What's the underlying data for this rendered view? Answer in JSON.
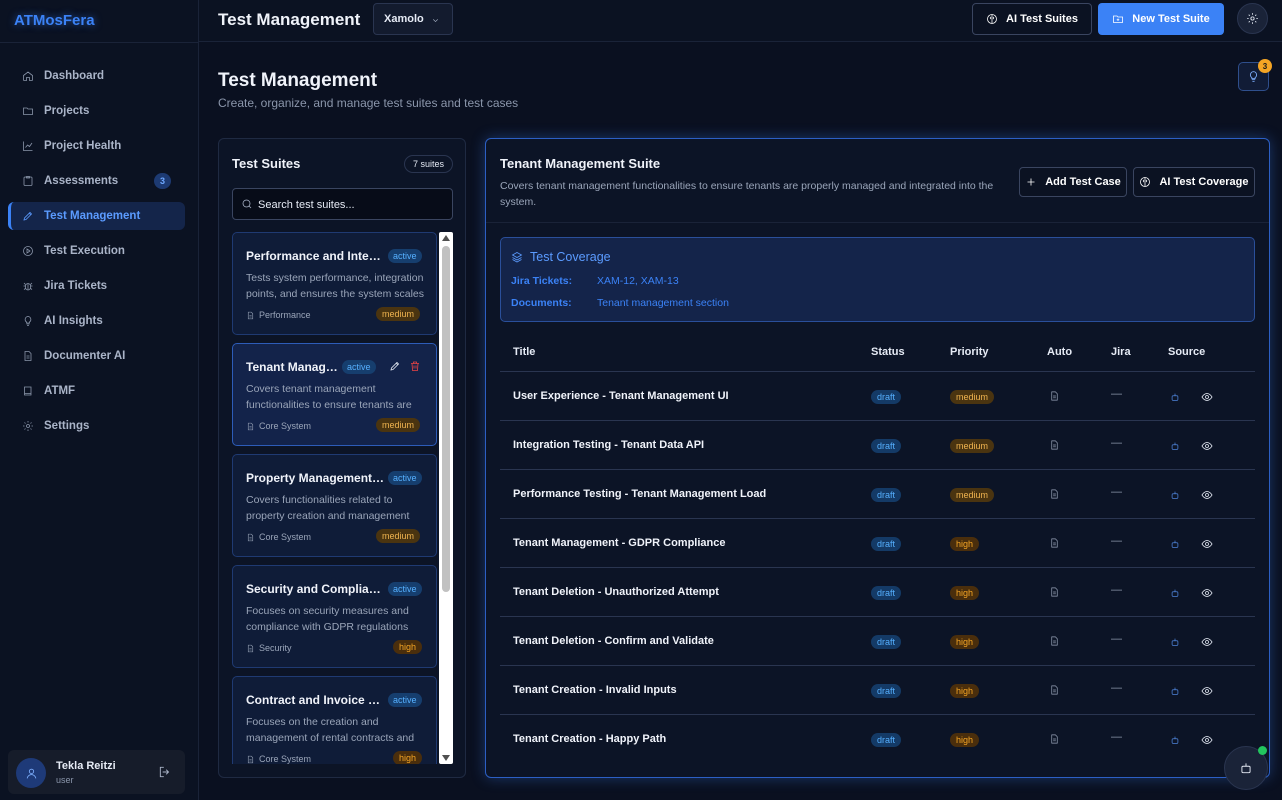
{
  "app": {
    "brand": "ATMosFera"
  },
  "nav": [
    {
      "label": "Dashboard",
      "icon": "home-icon"
    },
    {
      "label": "Projects",
      "icon": "folder-icon"
    },
    {
      "label": "Project Health",
      "icon": "chart-icon"
    },
    {
      "label": "Assessments",
      "icon": "clipboard-icon",
      "badge": "3"
    },
    {
      "label": "Test Management",
      "icon": "pencil-icon",
      "active": true
    },
    {
      "label": "Test Execution",
      "icon": "play-icon"
    },
    {
      "label": "Jira Tickets",
      "icon": "bug-icon"
    },
    {
      "label": "AI Insights",
      "icon": "lightbulb-icon"
    },
    {
      "label": "Documenter AI",
      "icon": "document-icon"
    },
    {
      "label": "ATMF",
      "icon": "book-icon"
    },
    {
      "label": "Settings",
      "icon": "gear-icon"
    }
  ],
  "user": {
    "name": "Tekla Reitzi",
    "role": "user"
  },
  "topbar": {
    "title": "Test Management",
    "project": "Xamolo",
    "ai_button": "AI Test Suites",
    "new_button": "New Test Suite"
  },
  "page": {
    "title": "Test Management",
    "subtitle": "Create, organize, and manage test suites and test cases",
    "insights_count": "3"
  },
  "suites": {
    "title": "Test Suites",
    "count_label": "7 suites",
    "search_placeholder": "Search test suites...",
    "items": [
      {
        "name": "Performance and Integration Testing",
        "status": "active",
        "description": "Tests system performance, integration points, and ensures the system scales",
        "category": "Performance",
        "priority": "medium"
      },
      {
        "name": "Tenant Management Suite",
        "status": "active",
        "description": "Covers tenant management functionalities to ensure tenants are properly managed",
        "category": "Core System",
        "priority": "medium",
        "selected": true
      },
      {
        "name": "Property Management Suite",
        "status": "active",
        "description": "Covers functionalities related to property creation and management",
        "category": "Core System",
        "priority": "medium"
      },
      {
        "name": "Security and Compliance",
        "status": "active",
        "description": "Focuses on security measures and compliance with GDPR regulations",
        "category": "Security",
        "priority": "high"
      },
      {
        "name": "Contract and Invoice Management",
        "status": "active",
        "description": "Focuses on the creation and management of rental contracts and invoices",
        "category": "Core System",
        "priority": "high"
      }
    ]
  },
  "detail": {
    "title": "Tenant Management Suite",
    "description": "Covers tenant management functionalities to ensure tenants are properly managed and integrated into the system.",
    "add_button": "Add Test Case",
    "coverage_button": "AI Test Coverage",
    "coverage": {
      "title": "Test Coverage",
      "jira_label": "Jira Tickets:",
      "jira_value": "XAM-12, XAM-13",
      "docs_label": "Documents:",
      "docs_value": "Tenant management section"
    },
    "columns": [
      "Title",
      "Status",
      "Priority",
      "Auto",
      "Jira",
      "Source"
    ],
    "rows": [
      {
        "title": "User Experience - Tenant Management UI",
        "status": "draft",
        "priority": "medium",
        "jira": "—"
      },
      {
        "title": "Integration Testing - Tenant Data API",
        "status": "draft",
        "priority": "medium",
        "jira": "—"
      },
      {
        "title": "Performance Testing - Tenant Management Load",
        "status": "draft",
        "priority": "medium",
        "jira": "—"
      },
      {
        "title": "Tenant Management - GDPR Compliance",
        "status": "draft",
        "priority": "high",
        "jira": "—"
      },
      {
        "title": "Tenant Deletion - Unauthorized Attempt",
        "status": "draft",
        "priority": "high",
        "jira": "—"
      },
      {
        "title": "Tenant Deletion - Confirm and Validate",
        "status": "draft",
        "priority": "high",
        "jira": "—"
      },
      {
        "title": "Tenant Creation - Invalid Inputs",
        "status": "draft",
        "priority": "high",
        "jira": "—"
      },
      {
        "title": "Tenant Creation - Happy Path",
        "status": "draft",
        "priority": "high",
        "jira": "—"
      }
    ]
  },
  "colors": {
    "accent": "#3b82f6",
    "background": "#0a1020",
    "medium": "#f0b450",
    "high": "#f5a524",
    "danger": "#ef4444"
  }
}
